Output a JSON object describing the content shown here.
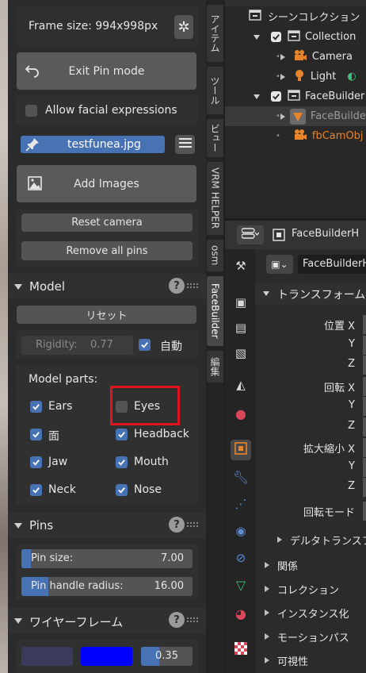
{
  "panel": {
    "frame_size": "Frame size: 994x998px",
    "exit_pin_mode": "Exit Pin mode",
    "allow_facial_expressions": "Allow facial expressions",
    "image_name": "testfunea.jpg",
    "add_images": "Add Images",
    "reset_camera": "Reset camera",
    "remove_all_pins": "Remove all pins",
    "model": {
      "title": "Model",
      "reset": "リセット",
      "rigidity_label": "Rigidity:",
      "rigidity_value": "0.77",
      "auto_label": "自動",
      "parts_title": "Model parts:",
      "parts": [
        {
          "label": "Ears",
          "checked": true
        },
        {
          "label": "Eyes",
          "checked": false
        },
        {
          "label": "面",
          "checked": true
        },
        {
          "label": "Headback",
          "checked": true
        },
        {
          "label": "Jaw",
          "checked": true
        },
        {
          "label": "Mouth",
          "checked": true
        },
        {
          "label": "Neck",
          "checked": true
        },
        {
          "label": "Nose",
          "checked": true
        }
      ]
    },
    "pins": {
      "title": "Pins",
      "pin_size_label": "Pin size:",
      "pin_size_value": "7.00",
      "pin_handle_label": "Pin handle radius:",
      "pin_handle_value": "16.00"
    },
    "wireframe": {
      "title": "ワイヤーフレーム",
      "opacity_value": "0.35",
      "color1": "#3a3a5a",
      "color2": "#0000ff"
    }
  },
  "vertical_tabs": [
    "アイテム",
    "ツール",
    "ビュー",
    "VRM HELPER",
    "osm",
    "FaceBuilder",
    "編集"
  ],
  "outliner": {
    "scene_collection": "シーンコレクション",
    "collection": "Collection",
    "camera": "Camera",
    "light": "Light",
    "facebuilder": "FaceBuilder",
    "facebuilder_head": "FaceBuilde",
    "fbcam": "fbCamObj"
  },
  "properties": {
    "header_object": "FaceBuilderH",
    "object_name": "FaceBuilderH",
    "transform": "トランスフォーム",
    "location": "位置 X",
    "rotation": "回転 X",
    "scale": "拡大縮小 X",
    "y": "Y",
    "z": "Z",
    "rotation_mode": "回転モード",
    "delta_transform": "デルタトランスフ",
    "relations": "関係",
    "collections": "コレクション",
    "instancing": "インスタンス化",
    "motion_paths": "モーションパス",
    "visibility": "可視性"
  },
  "colors": {
    "accent_blue": "#4772b3",
    "highlight_red": "#e0141e",
    "orange": "#e8842a"
  }
}
